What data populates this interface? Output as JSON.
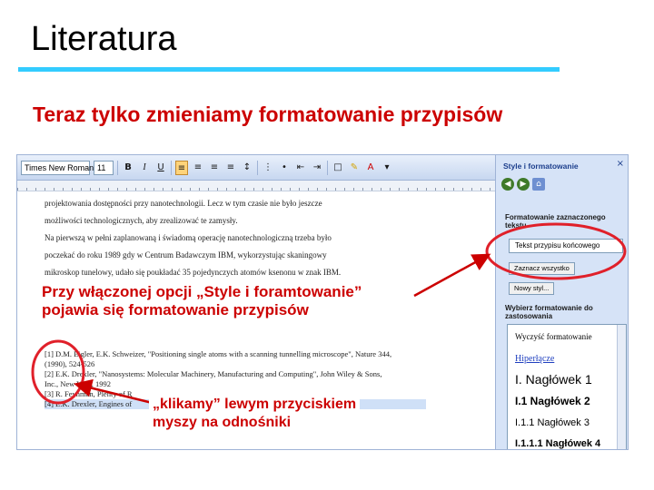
{
  "slide": {
    "title": "Literatura",
    "subtitle": "Teraz tylko zmieniamy formatowanie przypisów",
    "accent_color": "#33ccff",
    "text_color": "#cc0000"
  },
  "toolbar": {
    "font_name": "Times New Roman",
    "font_size": "11",
    "bold_label": "B",
    "italic_label": "I",
    "underline_label": "U"
  },
  "document": {
    "paragraphs": [
      "projektowania dostępności przy nanotechnologii. Lecz w tym czasie nie było jeszcze",
      "możliwości technologicznych, aby zrealizować te zamysły.",
      "Na pierwszą w pełni zaplanowaną i świadomą operację nanotechnologiczną trzeba było",
      "poczekać do roku 1989 gdy w Centrum Badawczym IBM, wykorzystując skaningowy",
      "mikroskop tunelowy, udało się poukładać 35 pojedynczych atomów ksenonu w znak IBM."
    ],
    "footnotes": [
      "[1] D.M. Eigler, E.K. Schweizer, \"Positioning single atoms with a scanning tunnelling microscope\", Nature 344,",
      "(1990), 524-526",
      "[2] E.K. Drexler, \"Nanosystems: Molecular Machinery, Manufacturing and Computing\", John Wiley & Sons,",
      "Inc., New York, 1992",
      "[3] R. Feynman, Plenty of R",
      "[4] E.K. Drexler, Engines of"
    ]
  },
  "styles_pane": {
    "title": "Style i formatowanie",
    "close_glyph": "×",
    "selected_heading": "Formatowanie zaznaczonego tekstu",
    "selected_style": "Tekst przypisu końcowego",
    "select_all_button": "Zaznacz wszystko",
    "new_style_button": "Nowy styl...",
    "apply_heading": "Wybierz formatowanie do zastosowania",
    "styles": [
      {
        "label": "Wyczyść formatowanie",
        "kind": "clear"
      },
      {
        "label": "Hiperłącze",
        "kind": "link"
      },
      {
        "label": "I. Nagłówek 1",
        "kind": "h1"
      },
      {
        "label": "I.1 Nagłówek 2",
        "kind": "h2"
      },
      {
        "label": "I.1.1 Nagłówek 3",
        "kind": "h3"
      },
      {
        "label": "I.1.1.1 Nagłówek 4",
        "kind": "h4"
      }
    ],
    "paragraph_mark": "¶"
  },
  "annotations": {
    "styles_note": "Przy włączonej opcji „Style i foramtowanie” pojawia się formatowanie przypisów",
    "styles_note_line1": "Przy włączonej opcji „Style i foramtowanie”",
    "styles_note_line2": "pojawia się formatowanie przypisów",
    "click_note_line1": "„klikamy” lewym przyciskiem",
    "click_note_line2": "myszy na odnośniki",
    "circle_color": "#e0202a"
  }
}
